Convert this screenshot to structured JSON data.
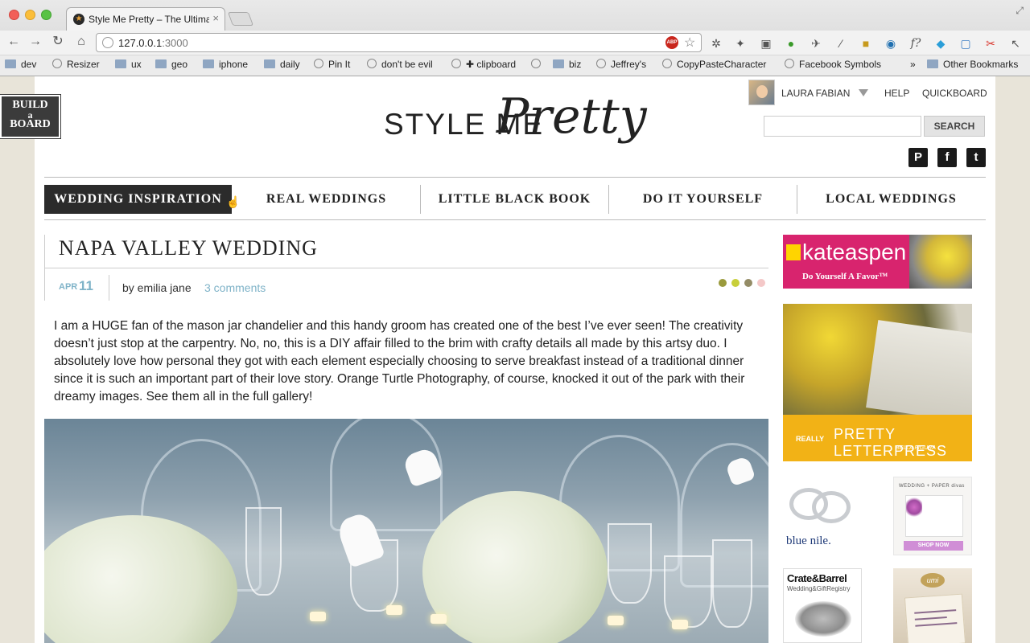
{
  "browser": {
    "tab_title": "Style Me Pretty – The Ultimat",
    "tab_close": "×",
    "url_host": "127.0.0.1",
    "url_port": ":3000",
    "abp_label": "ABP",
    "extensions": [
      "gear",
      "puzzle",
      "tape",
      "green-circle",
      "bird",
      "pipette",
      "truck",
      "eye",
      "f?",
      "lego",
      "window",
      "scissors",
      "cursor"
    ],
    "bookmarks": [
      {
        "label": "dev",
        "type": "folder"
      },
      {
        "label": "Resizer",
        "type": "page"
      },
      {
        "label": "ux",
        "type": "folder"
      },
      {
        "label": "geo",
        "type": "folder"
      },
      {
        "label": "iphone",
        "type": "folder"
      },
      {
        "label": "daily",
        "type": "folder"
      },
      {
        "label": "Pin It",
        "type": "page"
      },
      {
        "label": "don't be evil",
        "type": "page"
      },
      {
        "label": "✚ clipboard",
        "type": "page"
      },
      {
        "label": "",
        "type": "page"
      },
      {
        "label": "biz",
        "type": "folder"
      },
      {
        "label": "Jeffrey's",
        "type": "page"
      },
      {
        "label": "CopyPasteCharacter",
        "type": "page"
      },
      {
        "label": "Facebook Symbols",
        "type": "page"
      },
      {
        "label": "»",
        "type": "more"
      },
      {
        "label": "Other Bookmarks",
        "type": "folder"
      }
    ]
  },
  "site": {
    "build_board": [
      "BUILD",
      "a",
      "BOARD"
    ],
    "logo_style": "STYLE ME",
    "logo_pretty": "Pretty",
    "user_name": "LAURA FABIAN",
    "help": "HELP",
    "quickboard": "QUICKBOARD",
    "search_button": "SEARCH",
    "search_value": "",
    "social": [
      "P",
      "f",
      "t"
    ],
    "nav": [
      "WEDDING INSPIRATION",
      "REAL WEDDINGS",
      "LITTLE BLACK BOOK",
      "DO IT YOURSELF",
      "LOCAL WEDDINGS"
    ]
  },
  "article": {
    "title": "NAPA VALLEY WEDDING",
    "month": "APR",
    "day": "11",
    "author": "by emilia jane",
    "comments": "3 comments",
    "palette": [
      "#9a9a3c",
      "#c8cf3a",
      "#948c66",
      "#f4c8c8"
    ],
    "body": "I am a HUGE fan of the mason jar chandelier and this handy groom has created one of the best I’ve ever seen! The creativity doesn’t just stop at the carpentry. No, no, this is a DIY affair filled to the brim with crafty details all made by this artsy duo. I absolutely love how personal they got with each element especially choosing to serve breakfast instead of a traditional dinner since it is such an important part of their love story. Orange Turtle Photography, of course, knocked it out of the park with their dreamy images. See them all in the full gallery!"
  },
  "ads": {
    "kate_logo": "kateaspen",
    "kate_tag": "Do Yourself A Favor™",
    "lp_really": "REALLY",
    "lp_title": "PRETTY LETTERPRESS",
    "lp_sub": "BELLA FIGURA",
    "bluenile": "blue nile.",
    "wpd_title": "WEDDING + PAPER divas",
    "wpd_shop": "SHOP NOW",
    "crate_title": "Crate&Barrel",
    "crate_sub": "Wedding&GiftRegistry",
    "umi": "umi"
  }
}
